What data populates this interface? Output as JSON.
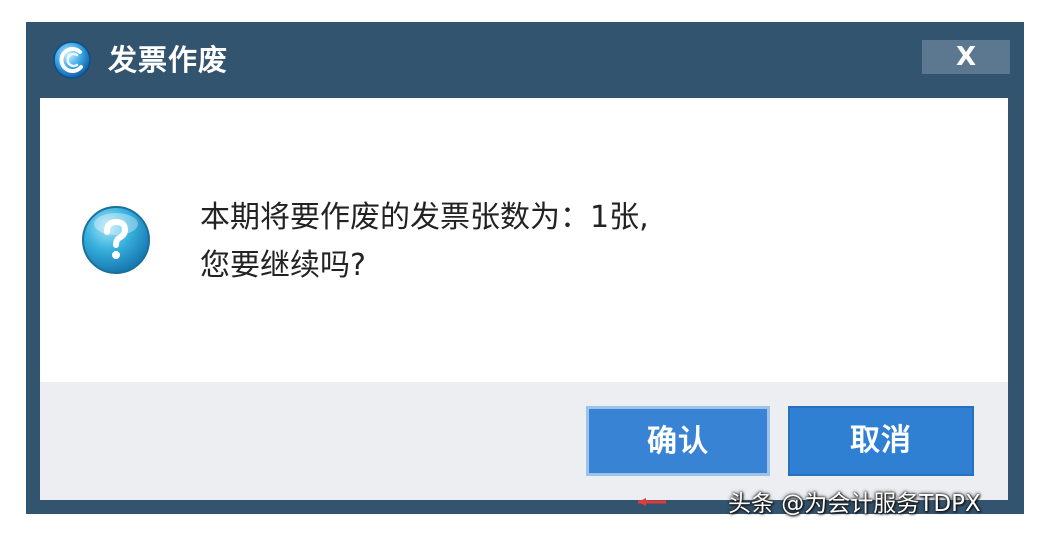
{
  "dialog": {
    "title": "发票作废",
    "close_label": "X",
    "message_line1": "本期将要作废的发票张数为：1张,",
    "message_line2": "您要继续吗?",
    "confirm_label": "确认",
    "cancel_label": "取消"
  },
  "watermark": "头条 @为会计服务TDPX",
  "icons": {
    "app": "app-logo-icon",
    "question": "question-icon"
  },
  "colors": {
    "frame": "#33546e",
    "button": "#2f80d2",
    "footer": "#eceef1"
  }
}
